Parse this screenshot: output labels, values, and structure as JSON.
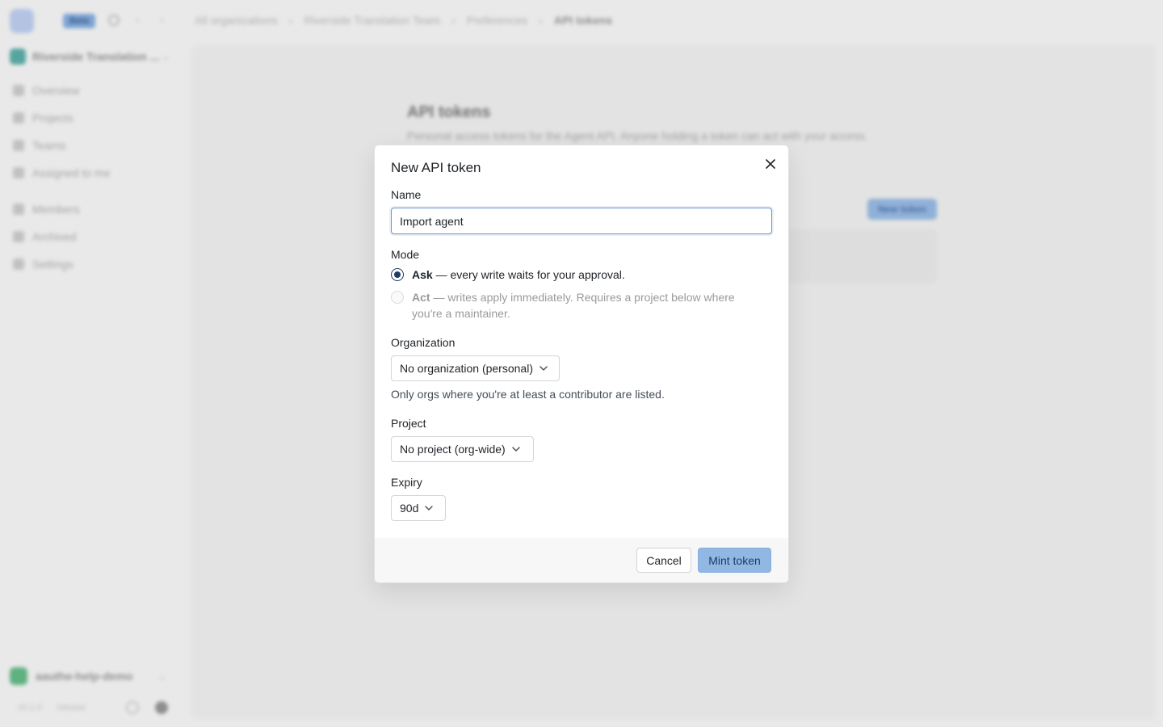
{
  "background": {
    "beta_badge": "Beta",
    "breadcrumbs": [
      "All organizations",
      "Riverside Translation Team",
      "Preferences",
      "API tokens"
    ],
    "org_switcher": "Riverside Translation ...",
    "nav": [
      "Overview",
      "Projects",
      "Teams",
      "Assigned to me",
      "Members",
      "Archived",
      "Settings"
    ],
    "account": "aauthe-help-demo",
    "footer_links": [
      "v0.1.0",
      "release"
    ],
    "page_title": "API tokens",
    "page_description": "Personal access tokens for the Agent API. Anyone holding a token can act with your access.",
    "new_token_button": "New token"
  },
  "dialog": {
    "title": "New API token",
    "name_label": "Name",
    "name_value": "Import agent",
    "mode_label": "Mode",
    "mode_ask_title": "Ask",
    "mode_ask_desc": " — every write waits for your approval.",
    "mode_act_title": "Act",
    "mode_act_desc": " — writes apply immediately. Requires a project below where you're a maintainer.",
    "organization_label": "Organization",
    "organization_value": "No organization (personal)",
    "organization_help": "Only orgs where you're at least a contributor are listed.",
    "project_label": "Project",
    "project_value": "No project (org-wide)",
    "expiry_label": "Expiry",
    "expiry_value": "90d",
    "cancel_label": "Cancel",
    "submit_label": "Mint token"
  },
  "colors": {
    "accent": "#90b8e2",
    "radio_selected": "#1f3a64",
    "input_focus": "#6f95c5"
  }
}
